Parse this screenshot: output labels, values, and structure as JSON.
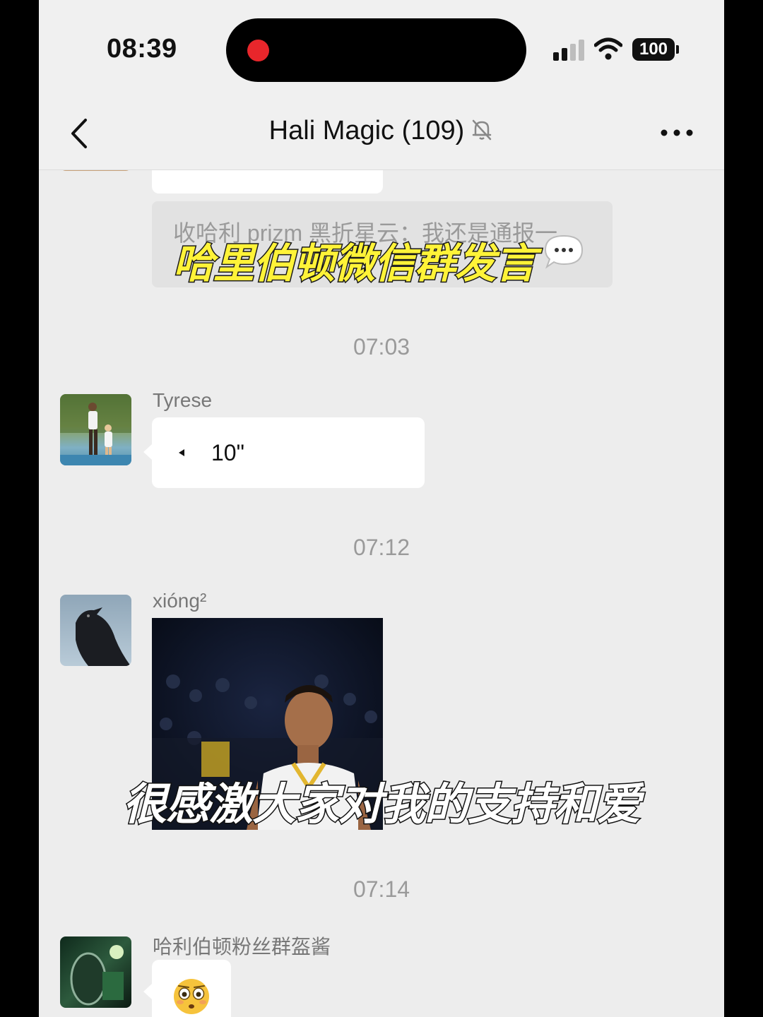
{
  "status_bar": {
    "time": "08:39",
    "battery": "100",
    "recording_indicator_color": "#e8262b"
  },
  "nav": {
    "title": "Hali Magic (109)",
    "back_icon": "chevron-left-icon",
    "muted_icon": "bell-slash-icon",
    "more_icon": "more-dots-icon"
  },
  "chat": {
    "quoted_message": "收哈利 prizm 黑折星云：我还是通报一",
    "timestamps": [
      "07:03",
      "07:12",
      "07:14"
    ],
    "messages": [
      {
        "sender": "Tyrese",
        "type": "voice",
        "duration": "10\""
      },
      {
        "sender": "xióng²",
        "type": "image"
      },
      {
        "sender": "哈利伯顿粉丝群盔酱",
        "type": "emoji",
        "emoji": "😳"
      }
    ]
  },
  "captions": {
    "top": "哈里伯顿微信群发言",
    "bottom": "很感激大家对我的支持和爱"
  },
  "colors": {
    "chat_background": "#ededed",
    "bubble": "#ffffff",
    "caption_top": "#fff338"
  }
}
